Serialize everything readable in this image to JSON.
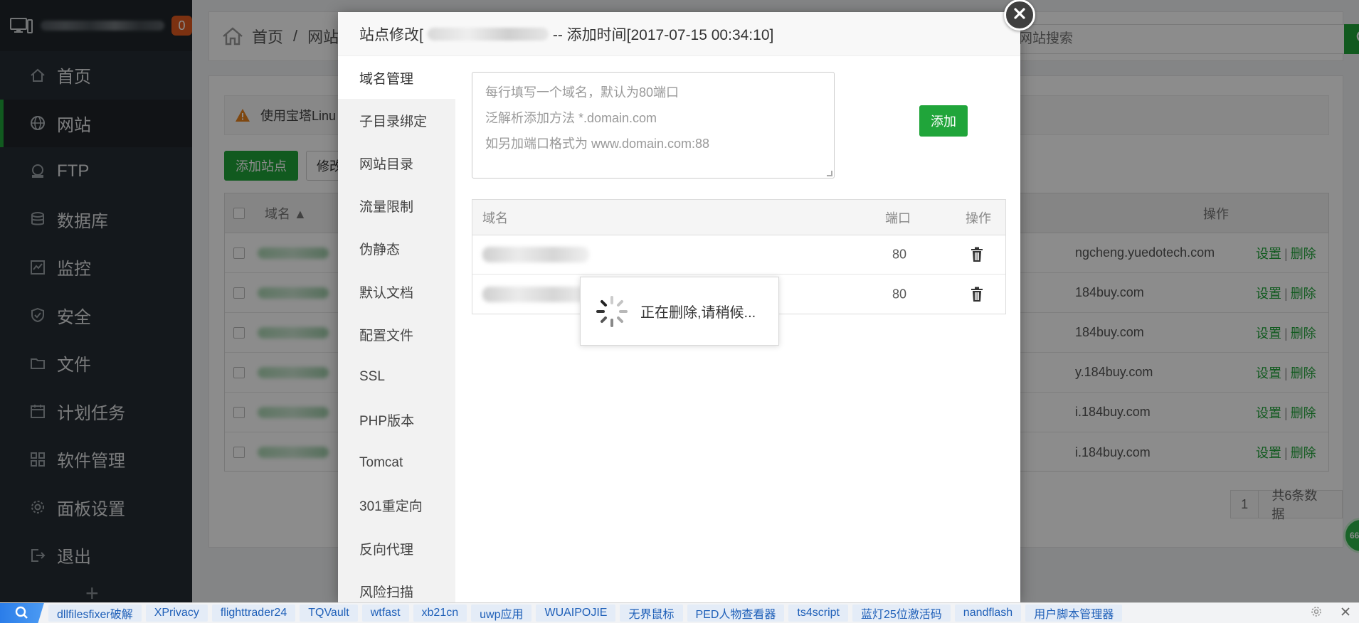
{
  "sidebar": {
    "badge_count": "0",
    "items": [
      {
        "label": "首页",
        "icon": "home-icon"
      },
      {
        "label": "网站",
        "icon": "globe-icon",
        "active": true
      },
      {
        "label": "FTP",
        "icon": "ftp-icon"
      },
      {
        "label": "数据库",
        "icon": "database-icon"
      },
      {
        "label": "监控",
        "icon": "monitor-icon"
      },
      {
        "label": "安全",
        "icon": "shield-icon"
      },
      {
        "label": "文件",
        "icon": "folder-icon"
      },
      {
        "label": "计划任务",
        "icon": "calendar-icon"
      },
      {
        "label": "软件管理",
        "icon": "apps-icon"
      },
      {
        "label": "面板设置",
        "icon": "gear-icon"
      },
      {
        "label": "退出",
        "icon": "logout-icon"
      }
    ],
    "plus": "+"
  },
  "breadcrumb": {
    "home": "首页",
    "sep": "/",
    "current": "网站"
  },
  "search": {
    "placeholder": "网站搜索"
  },
  "notice": {
    "text": "使用宝塔Linu"
  },
  "toolbar": {
    "add_site": "添加站点",
    "modify": "修改"
  },
  "site_table": {
    "head_name": "域名 ▲",
    "head_op": "操作",
    "rows": [
      {
        "domain": "ngcheng.yuedotech.com"
      },
      {
        "domain": "184buy.com"
      },
      {
        "domain": "184buy.com"
      },
      {
        "domain": "y.184buy.com"
      },
      {
        "domain": "i.184buy.com"
      },
      {
        "domain": "i.184buy.com"
      }
    ],
    "action_set": "设置",
    "action_sep": "|",
    "action_del": "删除"
  },
  "pager": {
    "page": "1",
    "total": "共6条数据"
  },
  "float_badge": "66",
  "modal": {
    "title_prefix": "站点修改[",
    "title_suffix": " -- 添加时间[2017-07-15 00:34:10]",
    "tabs": [
      "域名管理",
      "子目录绑定",
      "网站目录",
      "流量限制",
      "伪静态",
      "默认文档",
      "配置文件",
      "SSL",
      "PHP版本",
      "Tomcat",
      "301重定向",
      "反向代理",
      "风险扫描"
    ],
    "textarea_lines": [
      "每行填写一个域名，默认为80端口",
      "泛解析添加方法 *.domain.com",
      "如另加端口格式为 www.domain.com:88"
    ],
    "add_label": "添加",
    "table": {
      "col_domain": "域名",
      "col_port": "端口",
      "col_op": "操作",
      "rows": [
        {
          "port": "80"
        },
        {
          "port": "80"
        }
      ]
    }
  },
  "toast": {
    "text": "正在删除,请稍候..."
  },
  "bookmarks": [
    "dllfilesfixer破解",
    "XPrivacy",
    "flighttrader24",
    "TQVault",
    "wtfast",
    "xb21cn",
    "uwp应用",
    "WUAIPOJIE",
    "无界鼠标",
    "PED人物查看器",
    "ts4script",
    "蓝灯25位激活码",
    "nandflash",
    "用户脚本管理器"
  ],
  "colors": {
    "brand_green": "#20a53a",
    "sidebar_bg": "#262d33",
    "badge_orange": "#e05a1f"
  }
}
